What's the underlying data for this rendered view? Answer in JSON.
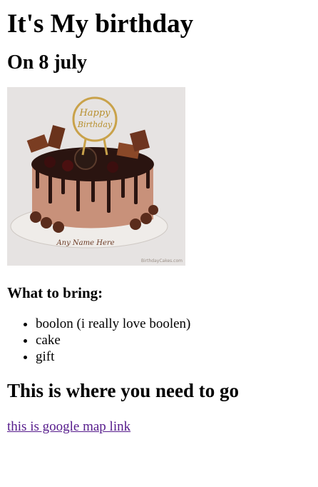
{
  "title": "It's My birthday",
  "date_heading": "On 8 july",
  "image": {
    "alt": "birthday cake",
    "topper_line1": "Happy",
    "topper_line2": "Birthday",
    "plaque_text": "Any Name Here",
    "watermark": "BirthdayCakes.com"
  },
  "bring_heading": "What to bring:",
  "bring_items": [
    "boolon (i really love boolen)",
    "cake",
    "gift"
  ],
  "location_heading": "This is where you need to go",
  "map_link_text": "this is google map link",
  "colors": {
    "link_visited": "#551a8b",
    "text": "#000000",
    "background": "#ffffff"
  }
}
